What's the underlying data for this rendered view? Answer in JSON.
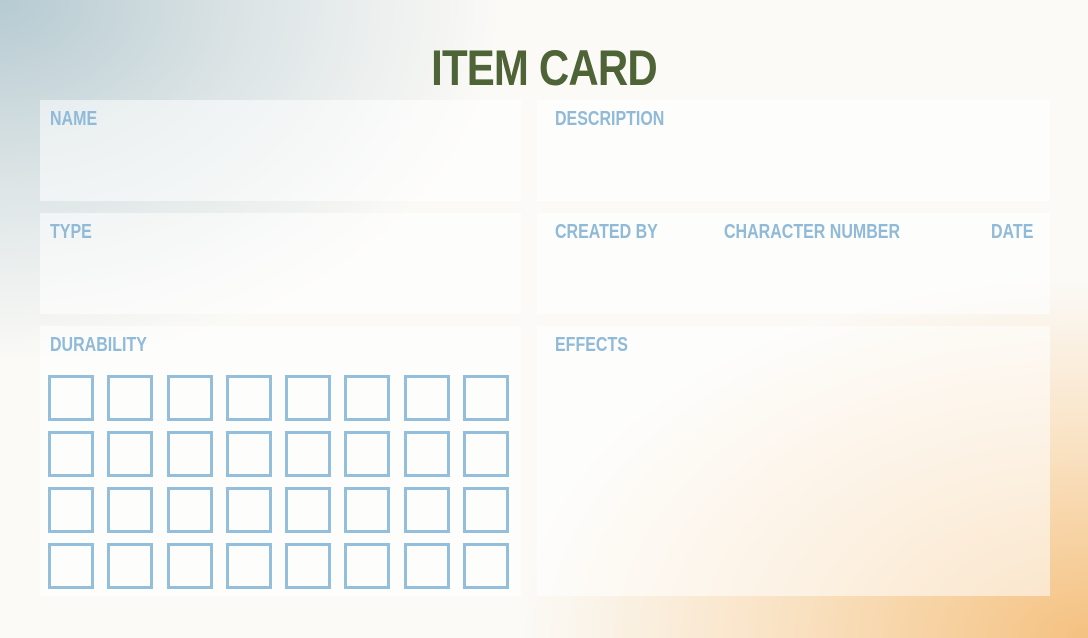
{
  "title": "ITEM CARD",
  "fields": {
    "name": "NAME",
    "description": "DESCRIPTION",
    "type": "TYPE",
    "created_by": "CREATED BY",
    "character_number": "CHARACTER NUMBER",
    "date": "DATE",
    "durability": "DURABILITY",
    "effects": "EFFECTS"
  },
  "durability_grid": {
    "rows": 4,
    "columns": 8
  },
  "colors": {
    "title": "#4e6336",
    "label": "#8fbad8",
    "box_border": "#93bedc",
    "gradient_top_left": "#b2c8d0",
    "gradient_bottom_right": "#f4be7a"
  }
}
